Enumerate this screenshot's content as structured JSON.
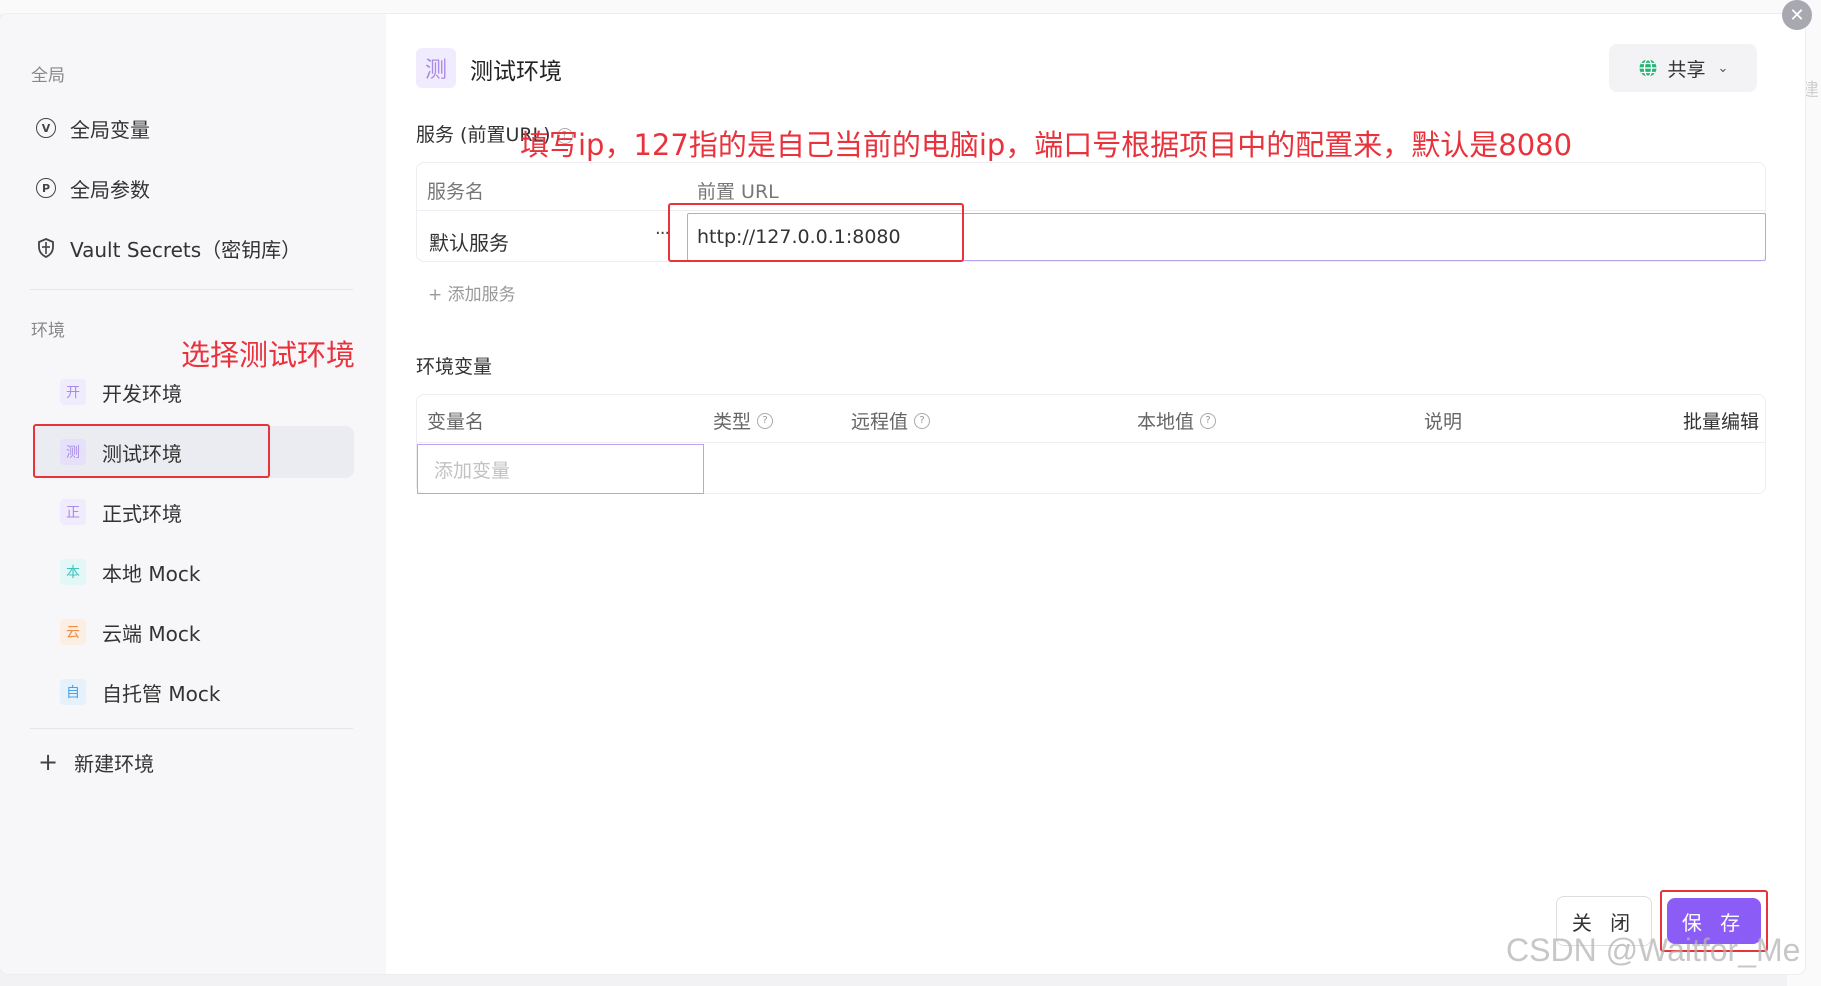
{
  "background": {
    "right_edge_text": "建"
  },
  "sidebar": {
    "global_section_title": "全局",
    "global_items": [
      {
        "icon": "v-circle-icon",
        "glyph": "V",
        "label": "全局变量"
      },
      {
        "icon": "p-circle-icon",
        "glyph": "P",
        "label": "全局参数"
      },
      {
        "icon": "shield-icon",
        "label": "Vault Secrets（密钥库）"
      }
    ],
    "env_section_title": "环境",
    "env_items": [
      {
        "badge": "开",
        "label": "开发环境",
        "color": "#a88ce6",
        "bg": "#f1ecfd"
      },
      {
        "badge": "测",
        "label": "测试环境",
        "color": "#a88ce6",
        "bg": "#e7e0fb",
        "active": true
      },
      {
        "badge": "正",
        "label": "正式环境",
        "color": "#a88ce6",
        "bg": "#f1ecfd"
      },
      {
        "badge": "本",
        "label": "本地 Mock",
        "color": "#3cc3bd",
        "bg": "#e3f7f6"
      },
      {
        "badge": "云",
        "label": "云端 Mock",
        "color": "#f08c4a",
        "bg": "#fdeee3"
      },
      {
        "badge": "自",
        "label": "自托管 Mock",
        "color": "#4aa3e8",
        "bg": "#e5f2fc"
      }
    ],
    "new_env_label": "新建环境"
  },
  "main": {
    "title_badge": "测",
    "title": "测试环境",
    "share_label": "共享",
    "services": {
      "section_label": "服务 (前置URL)",
      "col_name": "服务名",
      "col_url": "前置 URL",
      "rows": [
        {
          "name": "默认服务",
          "url": "http://127.0.0.1:8080"
        }
      ],
      "add_label": "+ 添加服务"
    },
    "variables": {
      "section_label": "环境变量",
      "col_name": "变量名",
      "col_type": "类型",
      "col_remote": "远程值",
      "col_local": "本地值",
      "col_desc": "说明",
      "bulk_edit": "批量编辑",
      "add_placeholder": "添加变量"
    },
    "close_label": "关 闭",
    "save_label": "保 存"
  },
  "annotations": {
    "select_env": "选择测试环境",
    "fill_ip": "填写ip，127指的是自己当前的电脑ip，端口号根据项目中的配置来，默认是8080"
  },
  "colors": {
    "accent": "#8b5cf6",
    "annotation": "#e8323c",
    "input_border": "#b7a3ef"
  },
  "watermark": "CSDN @Waitfor_Me"
}
